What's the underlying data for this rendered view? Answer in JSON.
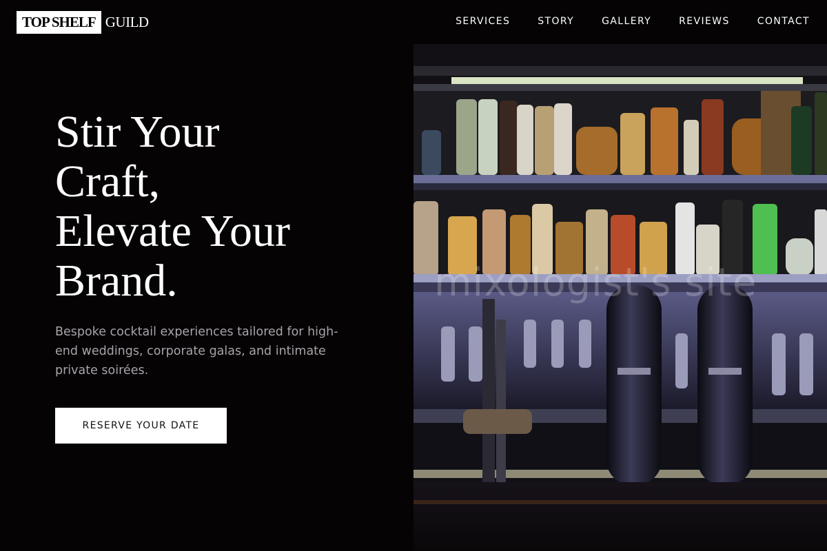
{
  "brand": {
    "box": "TOP SHELF",
    "text": "GUILD"
  },
  "nav": [
    "SERVICES",
    "STORY",
    "GALLERY",
    "REVIEWS",
    "CONTACT"
  ],
  "hero": {
    "title_lines": [
      "Stir Your",
      "Craft,",
      "Elevate Your",
      "Brand."
    ],
    "subtitle": "Bespoke cocktail experiences tailored for high-end weddings, corporate galas, and intimate private soirées.",
    "cta": "RESERVE YOUR DATE"
  },
  "image": {
    "subject": "back bar shelves with liquor bottles and beer taps",
    "watermark": "mixologist's site"
  },
  "colors": {
    "background": "#050304",
    "accent": "#ffffff",
    "muted_text": "#a9a4ab"
  }
}
